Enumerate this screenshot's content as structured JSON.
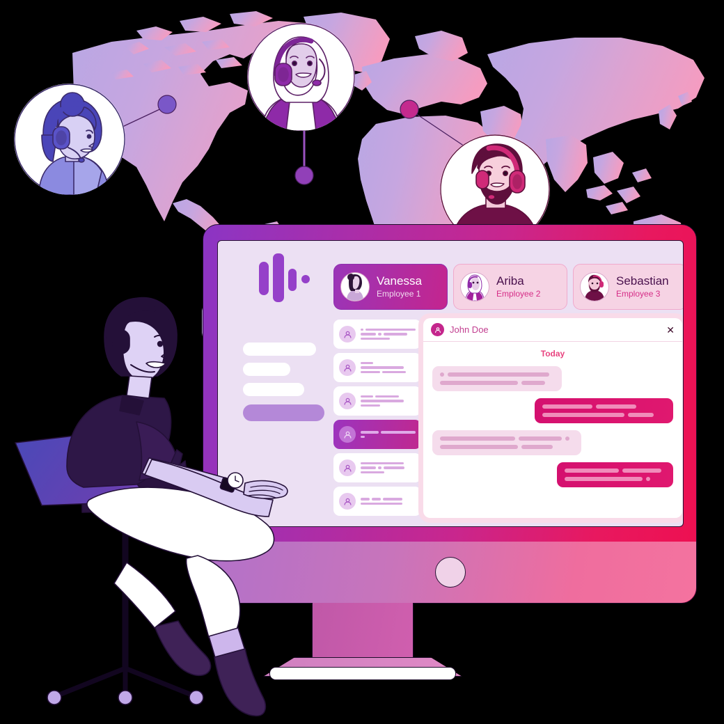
{
  "employee_tabs": [
    {
      "name": "Vanessa",
      "role": "Employee 1",
      "active": true,
      "avatar": "woman-dark-hair-avatar"
    },
    {
      "name": "Ariba",
      "role": "Employee 2",
      "active": false,
      "avatar": "woman-hijab-avatar"
    },
    {
      "name": "Sebastian",
      "role": "Employee 3",
      "active": false,
      "avatar": "bearded-man-avatar"
    }
  ],
  "chat": {
    "contact_name": "John Doe",
    "avatar_icon": "user-circle-icon",
    "close_icon": "close-icon",
    "date_divider": "Today",
    "messages": [
      {
        "direction": "in",
        "lines": [
          [
            6,
            96
          ],
          [
            88,
            26
          ]
        ],
        "leading_dot": true
      },
      {
        "direction": "out",
        "lines": [
          [
            72,
            58
          ],
          [
            58,
            37
          ]
        ],
        "leading_dot": false
      },
      {
        "direction": "in",
        "lines": [
          [
            108,
            62
          ],
          [
            112,
            45
          ]
        ],
        "leading_dot": false,
        "trailing_dot": true
      },
      {
        "direction": "out",
        "lines": [
          [
            78,
            56
          ],
          [
            112,
            10
          ]
        ],
        "leading_dot": false
      }
    ]
  },
  "contact_list": {
    "avatar_icon": "user-circle-icon",
    "items": [
      {
        "selected": false
      },
      {
        "selected": false
      },
      {
        "selected": false
      },
      {
        "selected": true
      },
      {
        "selected": false
      },
      {
        "selected": false
      }
    ]
  },
  "nav_rail": {
    "logo_icon": "audio-waveform-icon",
    "items": [
      {
        "active": false,
        "width": 105
      },
      {
        "active": false,
        "width": 68
      },
      {
        "active": false,
        "width": 88
      },
      {
        "active": true,
        "width": 117
      }
    ]
  },
  "map": {
    "pins": [
      {
        "id": "pin-north-america",
        "color": "#7a57c8"
      },
      {
        "id": "pin-africa",
        "color": "#9140b8"
      },
      {
        "id": "pin-asia",
        "color": "#c42a8e"
      }
    ],
    "avatars": [
      {
        "id": "agent-avatar-left",
        "theme": "blue-purple",
        "headset": true
      },
      {
        "id": "agent-avatar-center",
        "theme": "purple",
        "headset": true
      },
      {
        "id": "agent-avatar-right",
        "theme": "magenta",
        "headset": true
      }
    ]
  },
  "scene": {
    "seated_agent": "seated-call-center-agent",
    "chair": "office-chair",
    "monitor": "desktop-monitor"
  },
  "colors": {
    "purple": "#8b35c4",
    "magenta": "#c9268d",
    "pink": "#ee0f50",
    "screen_bg": "#ece0f3",
    "accent_text": "#d62d87"
  }
}
